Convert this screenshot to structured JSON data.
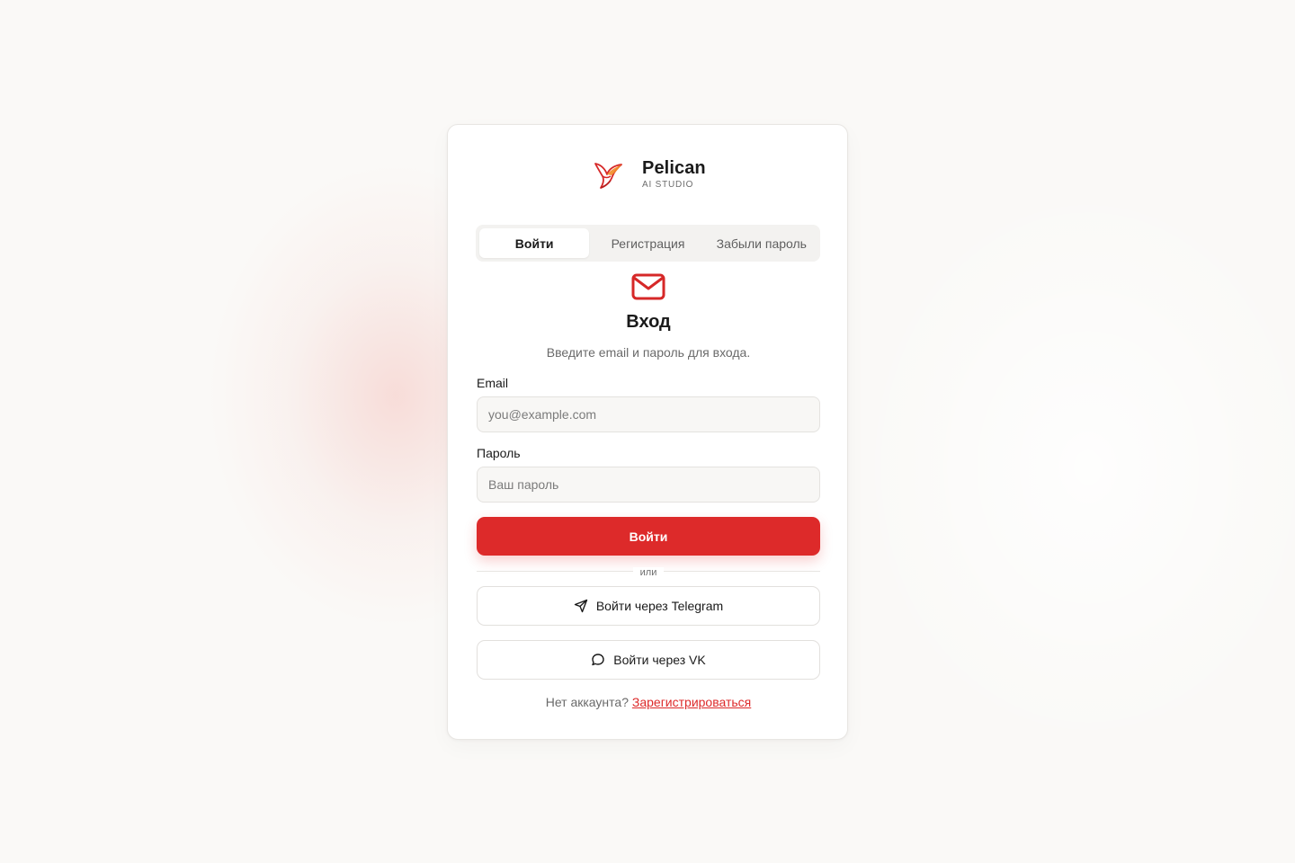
{
  "brand": {
    "name": "Pelican",
    "subtitle": "AI STUDIO",
    "logo_icon": "pelican-bird-icon"
  },
  "tabs": [
    {
      "label": "Войти",
      "active": true
    },
    {
      "label": "Регистрация",
      "active": false
    },
    {
      "label": "Забыли пароль",
      "active": false
    }
  ],
  "form": {
    "icon": "mail-icon",
    "title": "Вход",
    "subtitle": "Введите email и пароль для входа.",
    "email": {
      "label": "Email",
      "value": "",
      "placeholder": "you@example.com"
    },
    "password": {
      "label": "Пароль",
      "value": "",
      "placeholder": "Ваш пароль"
    },
    "submit_label": "Войти"
  },
  "divider_text": "или",
  "social": {
    "telegram": {
      "label": "Войти через Telegram",
      "icon": "send-icon"
    },
    "vk": {
      "label": "Войти через VK",
      "icon": "chat-bubble-icon"
    }
  },
  "footer": {
    "prompt": "Нет аккаунта?",
    "link": "Зарегистрироваться"
  },
  "colors": {
    "accent": "#dd2a2a",
    "background": "#faf9f7",
    "card": "#ffffff"
  }
}
